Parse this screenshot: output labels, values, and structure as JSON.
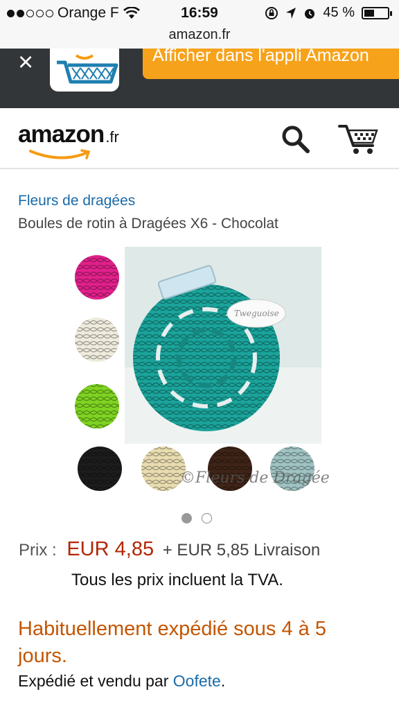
{
  "status_bar": {
    "carrier": "Orange F",
    "time": "16:59",
    "battery_percent": "45 %",
    "battery_level": 0.45
  },
  "url_bar": {
    "url": "amazon.fr"
  },
  "app_banner": {
    "close_label": "×",
    "open_app_label": "Afficher dans l'appli Amazon"
  },
  "header": {
    "logo_text": "amazon",
    "logo_tld": ".fr",
    "icons": [
      "search-icon",
      "cart-icon"
    ]
  },
  "product": {
    "brand": "Fleurs de dragées",
    "title": "Boules de rotin à Dragées X6 - Chocolat",
    "image_watermark": "©Fleurs de Dragées",
    "image_tag": "Tweguoise",
    "colors": [
      "#e0208a",
      "#eeeadc",
      "#7ed321",
      "#1c1c1c",
      "#e8dcb0",
      "#3e2417",
      "#9fc3c2",
      "#1aa39a"
    ],
    "pager": {
      "count": 2,
      "active_index": 0
    }
  },
  "pricing": {
    "label": "Prix :",
    "price": "EUR 4,85",
    "shipping": "+ EUR 5,85 Livraison",
    "vat_note": "Tous les prix incluent la TVA."
  },
  "availability": "Habituellement expédié sous 4 à 5 jours.",
  "seller": {
    "prefix": "Expédié et vendu par ",
    "name": "Oofete",
    "suffix": "."
  },
  "colors": {
    "link": "#1a6ba8",
    "price": "#b12704",
    "availability": "#c45500",
    "banner_bg": "#333638",
    "banner_button": "#f7a21b",
    "amazon_orange": "#f59b12"
  }
}
